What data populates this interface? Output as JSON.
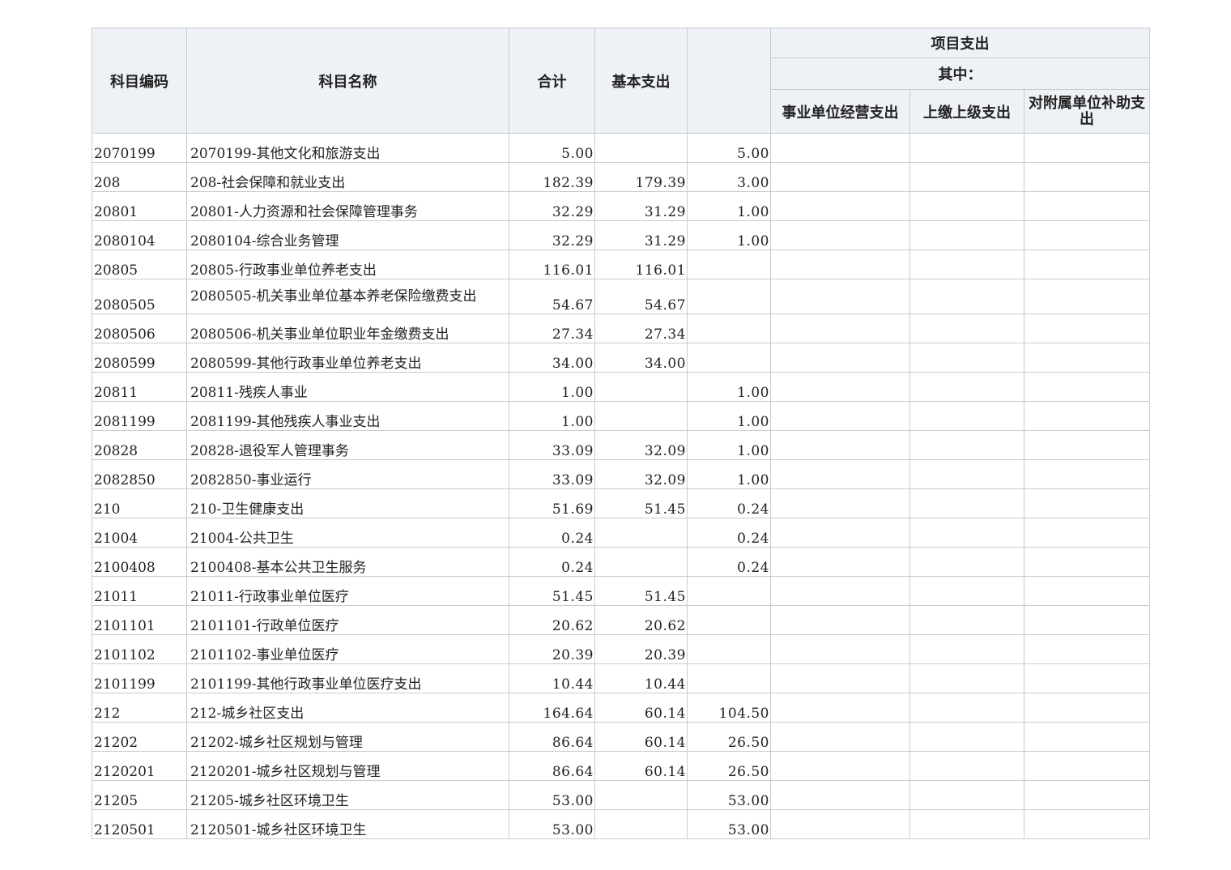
{
  "header": {
    "code": "科目编码",
    "name": "科目名称",
    "total": "合计",
    "basic": "基本支出",
    "project": "项目支出",
    "of_which": "其中：",
    "sub1": "事业单位经营支出",
    "sub2": "上缴上级支出",
    "sub3": "对附属单位补助支出"
  },
  "rows": [
    {
      "code": "2070199",
      "name": "2070199-其他文化和旅游支出",
      "total": "5.00",
      "basic": "",
      "project": "5.00"
    },
    {
      "code": "208",
      "name": "208-社会保障和就业支出",
      "total": "182.39",
      "basic": "179.39",
      "project": "3.00"
    },
    {
      "code": "20801",
      "name": "20801-人力资源和社会保障管理事务",
      "total": "32.29",
      "basic": "31.29",
      "project": "1.00"
    },
    {
      "code": "2080104",
      "name": "2080104-综合业务管理",
      "total": "32.29",
      "basic": "31.29",
      "project": "1.00"
    },
    {
      "code": "20805",
      "name": "20805-行政事业单位养老支出",
      "total": "116.01",
      "basic": "116.01",
      "project": ""
    },
    {
      "code": "2080505",
      "name": "2080505-机关事业单位基本养老保险缴费支出",
      "total": "54.67",
      "basic": "54.67",
      "project": ""
    },
    {
      "code": "2080506",
      "name": "2080506-机关事业单位职业年金缴费支出",
      "total": "27.34",
      "basic": "27.34",
      "project": ""
    },
    {
      "code": "2080599",
      "name": "2080599-其他行政事业单位养老支出",
      "total": "34.00",
      "basic": "34.00",
      "project": ""
    },
    {
      "code": "20811",
      "name": "20811-残疾人事业",
      "total": "1.00",
      "basic": "",
      "project": "1.00"
    },
    {
      "code": "2081199",
      "name": "2081199-其他残疾人事业支出",
      "total": "1.00",
      "basic": "",
      "project": "1.00"
    },
    {
      "code": "20828",
      "name": "20828-退役军人管理事务",
      "total": "33.09",
      "basic": "32.09",
      "project": "1.00"
    },
    {
      "code": "2082850",
      "name": "2082850-事业运行",
      "total": "33.09",
      "basic": "32.09",
      "project": "1.00"
    },
    {
      "code": "210",
      "name": "210-卫生健康支出",
      "total": "51.69",
      "basic": "51.45",
      "project": "0.24"
    },
    {
      "code": "21004",
      "name": "21004-公共卫生",
      "total": "0.24",
      "basic": "",
      "project": "0.24"
    },
    {
      "code": "2100408",
      "name": "2100408-基本公共卫生服务",
      "total": "0.24",
      "basic": "",
      "project": "0.24"
    },
    {
      "code": "21011",
      "name": "21011-行政事业单位医疗",
      "total": "51.45",
      "basic": "51.45",
      "project": ""
    },
    {
      "code": "2101101",
      "name": "2101101-行政单位医疗",
      "total": "20.62",
      "basic": "20.62",
      "project": ""
    },
    {
      "code": "2101102",
      "name": "2101102-事业单位医疗",
      "total": "20.39",
      "basic": "20.39",
      "project": ""
    },
    {
      "code": "2101199",
      "name": "2101199-其他行政事业单位医疗支出",
      "total": "10.44",
      "basic": "10.44",
      "project": ""
    },
    {
      "code": "212",
      "name": "212-城乡社区支出",
      "total": "164.64",
      "basic": "60.14",
      "project": "104.50"
    },
    {
      "code": "21202",
      "name": "21202-城乡社区规划与管理",
      "total": "86.64",
      "basic": "60.14",
      "project": "26.50"
    },
    {
      "code": "2120201",
      "name": "2120201-城乡社区规划与管理",
      "total": "86.64",
      "basic": "60.14",
      "project": "26.50"
    },
    {
      "code": "21205",
      "name": "21205-城乡社区环境卫生",
      "total": "53.00",
      "basic": "",
      "project": "53.00"
    },
    {
      "code": "2120501",
      "name": "2120501-城乡社区环境卫生",
      "total": "53.00",
      "basic": "",
      "project": "53.00"
    }
  ]
}
